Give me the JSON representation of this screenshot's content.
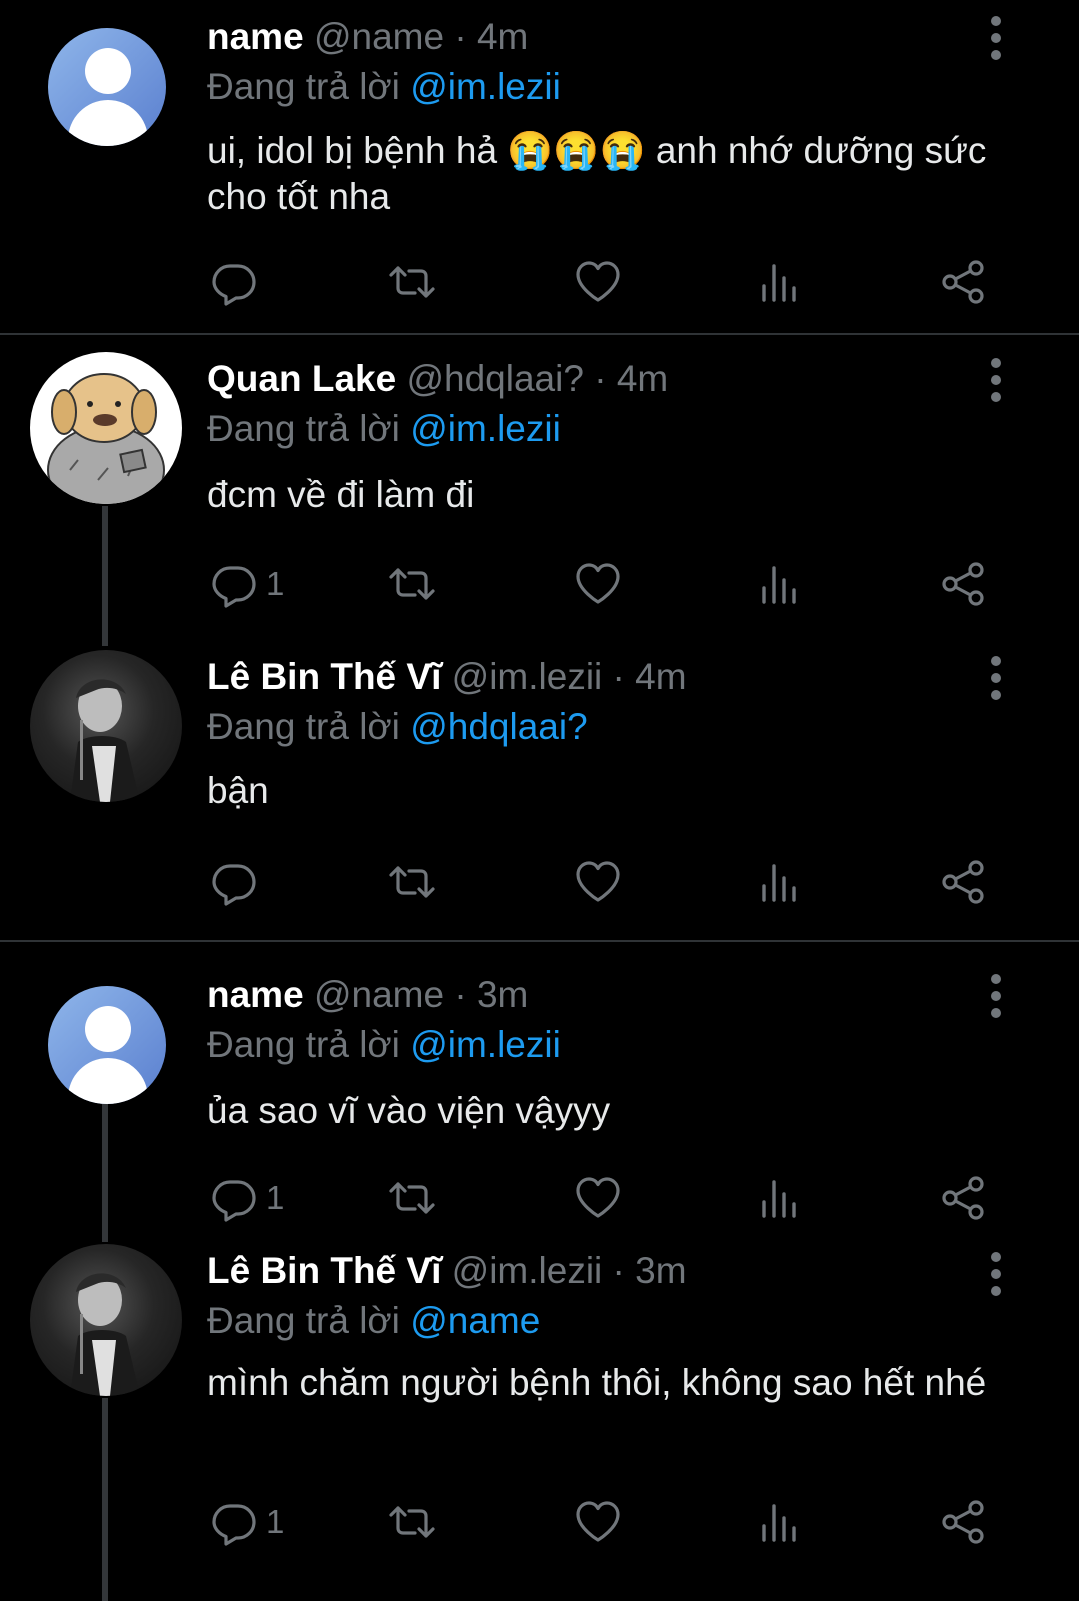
{
  "reply_prefix": "Đang trả lời",
  "tweets": [
    {
      "name": "name",
      "handle": "@name",
      "dot": "·",
      "time": "4m",
      "reply_to": "@im.lezii",
      "text": "ui, idol bị bệnh hả 😭😭😭 anh nhớ dưỡng sức cho tốt nha",
      "reply_count": ""
    },
    {
      "name": "Quan Lake",
      "handle": "@hdqlaai?",
      "dot": "·",
      "time": "4m",
      "reply_to": "@im.lezii",
      "text": "đcm về đi làm đi",
      "reply_count": "1"
    },
    {
      "name": "Lê Bin Thế Vĩ",
      "handle": "@im.lezii",
      "dot": "·",
      "time": "4m",
      "reply_to": "@hdqlaai?",
      "text": "bận",
      "reply_count": ""
    },
    {
      "name": "name",
      "handle": "@name",
      "dot": "·",
      "time": "3m",
      "reply_to": "@im.lezii",
      "text": "ủa sao vĩ vào viện vậyyy",
      "reply_count": "1"
    },
    {
      "name": "Lê Bin Thế Vĩ",
      "handle": "@im.lezii",
      "dot": "·",
      "time": "3m",
      "reply_to": "@name",
      "text": "mình chăm người bệnh thôi, không sao hết nhé",
      "reply_count": "1"
    }
  ],
  "icons": [
    "reply-icon",
    "retweet-icon",
    "like-icon",
    "views-icon",
    "share-icon",
    "more-icon"
  ],
  "colors": {
    "background": "#000000",
    "accent": "#1d9bf0",
    "muted": "#71767b",
    "text": "#e7e9ea"
  }
}
